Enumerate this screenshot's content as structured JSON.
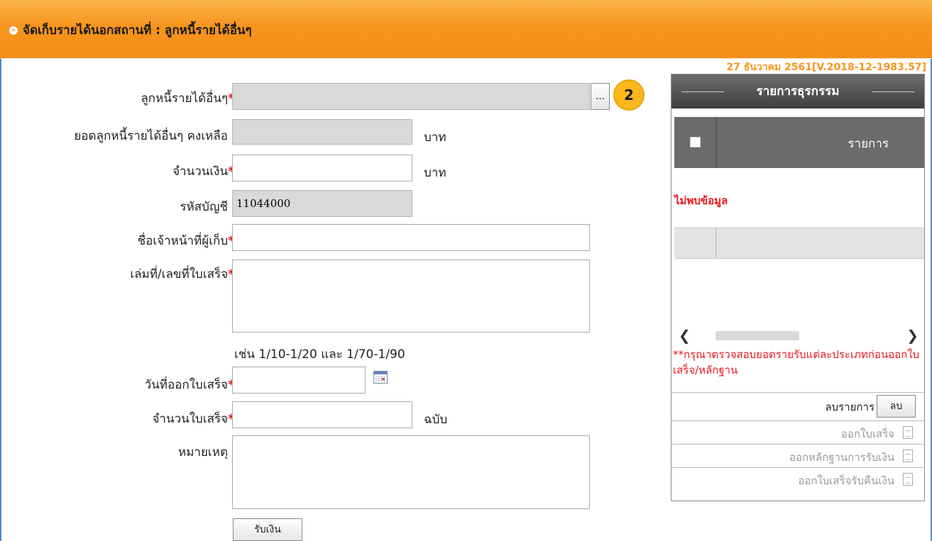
{
  "header": {
    "title": "จัดเก็บรายได้นอกสถานที่ : ลูกหนี้รายได้อื่นๆ",
    "icon": "arrow-circle-icon",
    "version": "27 ธันวาคม 2561[V.2018-12-1983.57]"
  },
  "form": {
    "debtor_label": "ลูกหนี้รายได้อื่นๆ",
    "debtor_value": "",
    "browse_label": "...",
    "step_badge": "2",
    "balance_label": "ยอดลูกหนี้รายได้อื่นๆ คงเหลือ",
    "balance_value": "",
    "balance_unit": "บาท",
    "amount_label": "จำนวนเงิน",
    "amount_value": "",
    "amount_unit": "บาท",
    "account_label": "รหัสบัญชี",
    "account_value": "11044000",
    "collector_label": "ชื่อเจ้าหน้าที่ผู้เก็บ",
    "collector_value": "",
    "receipt_no_label": "เล่มที่/เลขที่ใบเสร็จ",
    "receipt_no_value": "",
    "receipt_no_hint": "เช่น 1/10-1/20 และ 1/70-1/90",
    "issue_date_label": "วันที่ออกใบเสร็จ",
    "issue_date_value": "",
    "receipt_count_label": "จำนวนใบเสร็จ",
    "receipt_count_value": "",
    "receipt_count_unit": "ฉบับ",
    "note_label": "หมายเหตุ",
    "note_value": "",
    "submit_label": "รับเงิน",
    "required_mark": "*"
  },
  "panel": {
    "title": "รายการธุรกรรม",
    "column_item": "รายการ",
    "no_data": "ไม่พบข้อมูล",
    "warning": "**กรุณาตรวจสอบยอดรายรับแต่ละประเภทก่อนออกใบเสร็จ/หลักฐาน",
    "delete_label": "ลบรายการ",
    "delete_button": "ลบ",
    "issue_receipt": "ออกใบเสร็จ",
    "issue_evidence": "ออกหลักฐานการรับเงิน",
    "issue_refund": "ออกใบเสร็จรับคืนเงิน",
    "scroll_left": "❮",
    "scroll_right": "❯",
    "status_color": "#e8161b",
    "accent_color": "#f7941d"
  }
}
